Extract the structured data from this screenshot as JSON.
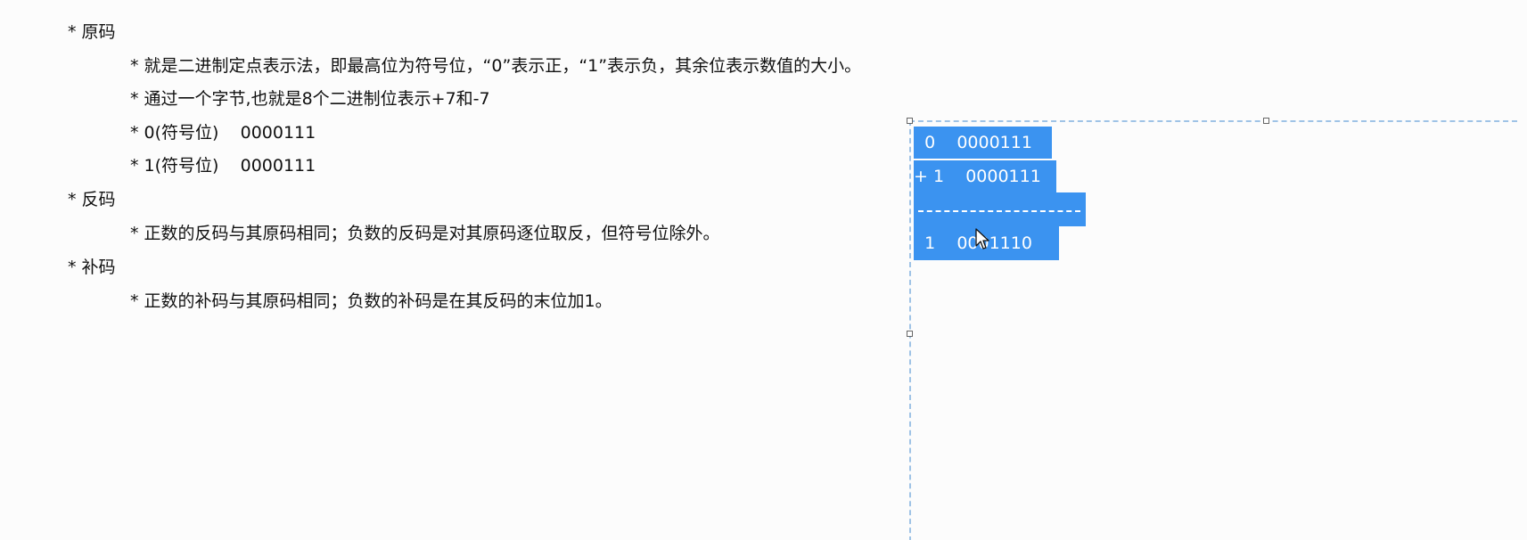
{
  "left_text": {
    "h_yuanma": "* 原码",
    "yuanma_desc": "* 就是二进制定点表示法，即最高位为符号位，“0”表示正，“1”表示负，其余位表示数值的大小。",
    "yuanma_byte": "* 通过一个字节,也就是8个二进制位表示+7和-7",
    "yuanma_pos": "* 0(符号位)    0000111",
    "yuanma_neg": "* 1(符号位)    0000111",
    "h_fanma": "* 反码",
    "fanma_desc": "* 正数的反码与其原码相同；负数的反码是对其原码逐位取反，但符号位除外。",
    "h_buma": "* 补码",
    "buma_desc": "* 正数的补码与其原码相同；负数的补码是在其反码的末位加1。"
  },
  "calc_box": {
    "row1": "  0    0000111",
    "row2": "+ 1    0000111",
    "result": "  1    0001110"
  },
  "colors": {
    "selection": "#3b93f0",
    "box_border": "#9fc3e6"
  },
  "icons": {
    "cursor": "mouse-pointer-icon"
  }
}
